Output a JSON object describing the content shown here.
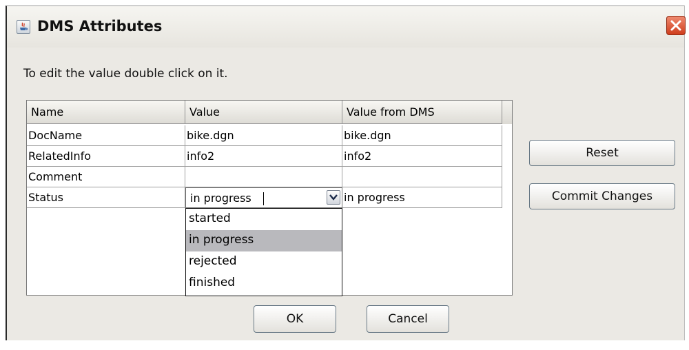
{
  "window": {
    "title": "DMS Attributes"
  },
  "instruction": "To edit the value double click on it.",
  "table": {
    "headers": [
      "Name",
      "Value",
      "Value from DMS"
    ],
    "rows": [
      {
        "name": "DocName",
        "value": "bike.dgn",
        "dms": "bike.dgn"
      },
      {
        "name": "RelatedInfo",
        "value": "info2",
        "dms": "info2"
      },
      {
        "name": "Comment",
        "value": "",
        "dms": ""
      },
      {
        "name": "Status",
        "value": "in progress",
        "dms": "in progress"
      }
    ]
  },
  "status_combo": {
    "value": "in progress",
    "options": [
      "started",
      "in progress",
      "rejected",
      "finished"
    ],
    "highlighted": "in progress"
  },
  "buttons": {
    "reset": "Reset",
    "commit": "Commit Changes",
    "ok": "OK",
    "cancel": "Cancel"
  },
  "icons": {
    "app": "java-app-icon",
    "close": "close-icon",
    "dropdown": "chevron-down-icon"
  },
  "colors": {
    "close_button": "#d9512f",
    "selection": "#b9b9bd",
    "window_bg": "#ebe9e4"
  }
}
